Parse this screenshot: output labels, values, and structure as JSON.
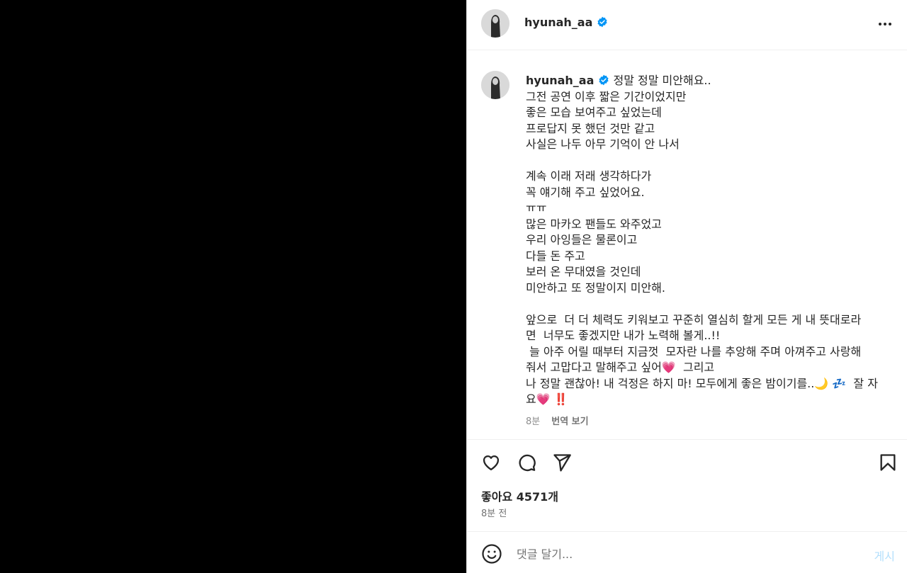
{
  "post": {
    "username": "hyunah_aa",
    "caption_lines": [
      "그전 공연 이후 짧은 기간이었지만",
      "좋은 모습 보여주고 싶었는데",
      "프로답지 못 했던 것만 같고",
      "사실은 나두 아무 기억이 안 나서",
      "",
      "계속 이래 저래 생각하다가",
      "꼭 얘기해 주고 싶었어요.",
      "ㅠㅠ",
      "많은 마카오 팬들도 와주었고",
      "우리 아잉들은 물론이고",
      "다들 돈 주고",
      "보러 온 무대였을 것인데",
      "미안하고 또 정말이지 미안해.",
      "",
      "앞으로  더 더 체력도 키워보고 꾸준히 열심히 할게 모든 게 내 뜻대로라",
      "면  너무도 좋겠지만 내가 노력해 볼게..!!",
      " 늘 아주 어릴 때부터 지금껏  모자란 나를 추앙해 주며 아껴주고 사랑해",
      "줘서 고맙다고 말해주고 싶어💗  그리고",
      "나 정말 괜찮아! 내 걱정은 하지 마! 모두에게 좋은 밤이기를..🌙 💤  잘 자",
      "요💗 ‼️"
    ],
    "caption_first": "정말 정말 미안해요..",
    "caption_time": "8분",
    "translate_label": "번역 보기",
    "likes_text": "좋아요 4571개",
    "posted_ago": "8분 전"
  },
  "comment": {
    "placeholder": "댓글 달기...",
    "post_label": "게시"
  },
  "icons": {
    "verified": "verified-badge-icon",
    "more": "more-horizontal-icon",
    "like": "heart-icon",
    "comment": "comment-icon",
    "share": "send-icon",
    "save": "bookmark-icon",
    "emoji": "emoji-icon"
  },
  "colors": {
    "verified": "#0095f6",
    "post_button": "#b2dffc",
    "media_background": "#000000"
  }
}
